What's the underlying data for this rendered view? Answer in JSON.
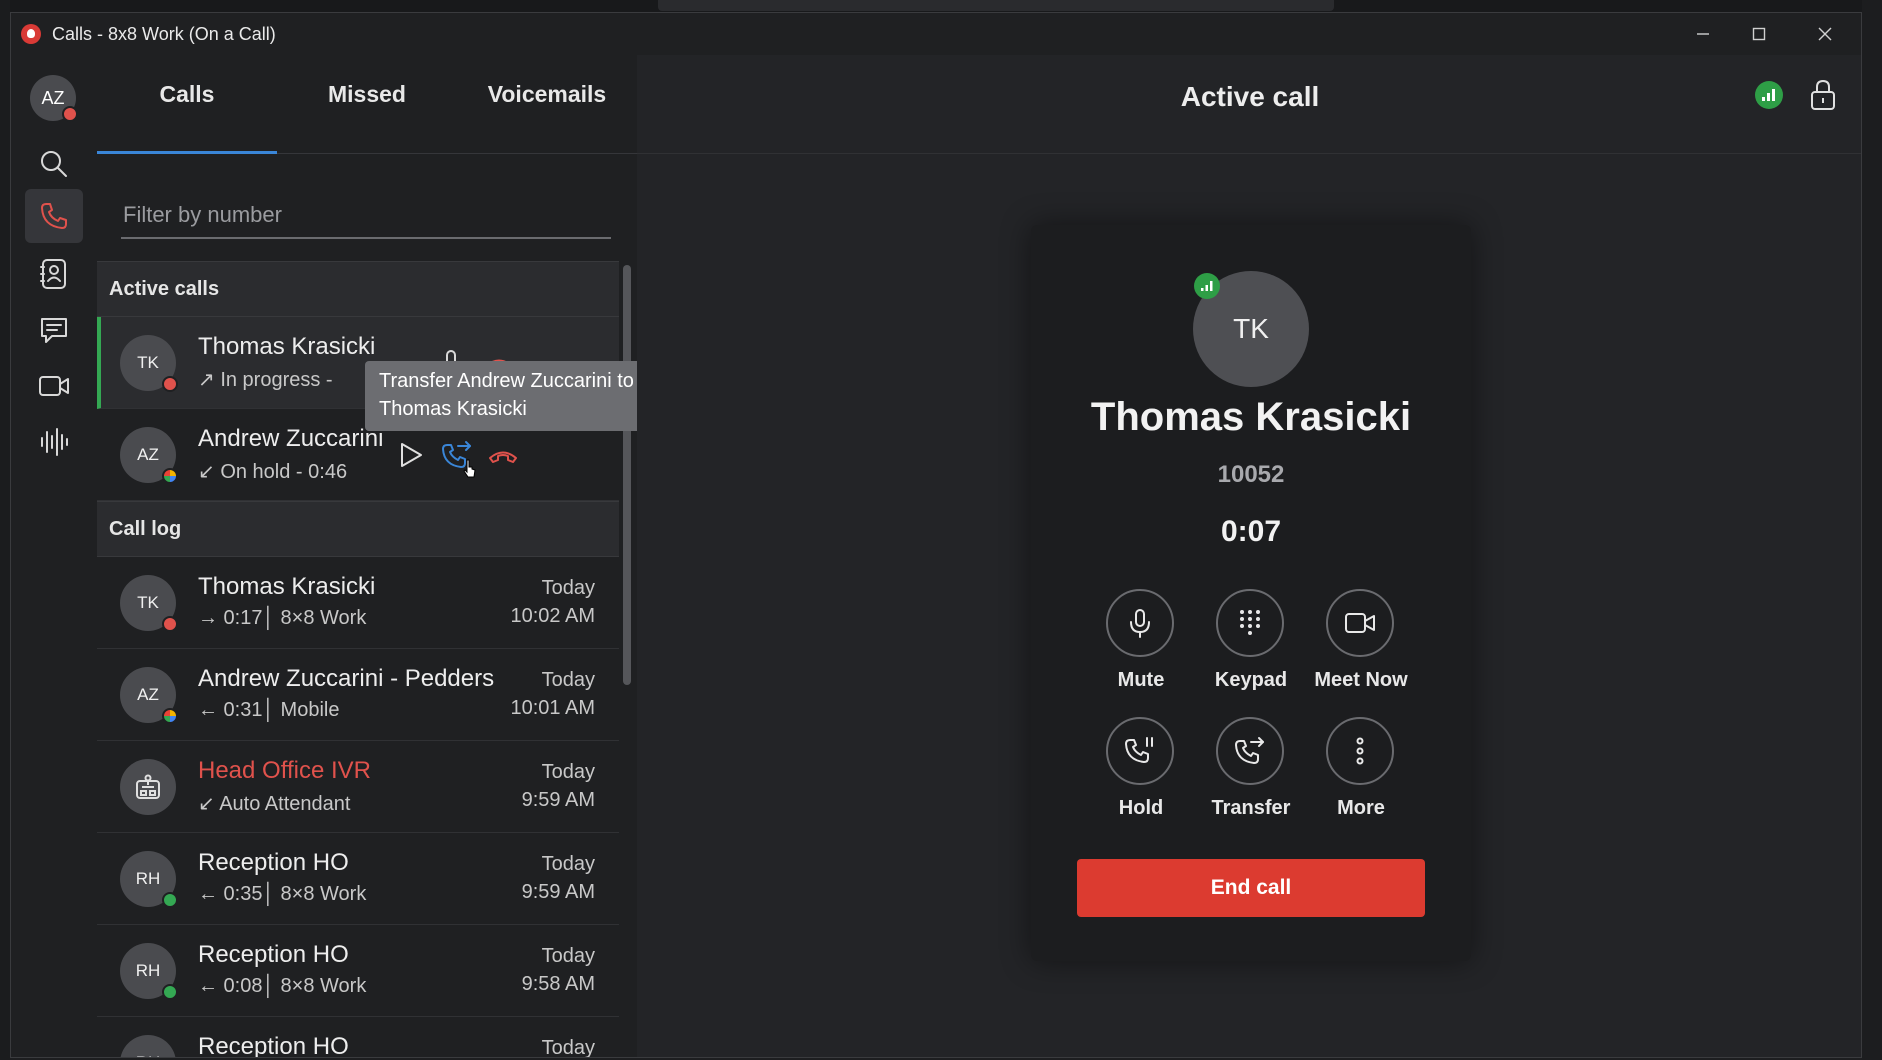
{
  "window": {
    "title": "Calls - 8x8 Work (On a Call)"
  },
  "rail": {
    "avatar_initials": "AZ"
  },
  "tabs": [
    {
      "label": "Calls",
      "active": true
    },
    {
      "label": "Missed",
      "active": false
    },
    {
      "label": "Voicemails",
      "active": false
    }
  ],
  "filter": {
    "placeholder": "Filter by number",
    "value": ""
  },
  "active_calls": {
    "header": "Active calls",
    "items": [
      {
        "initials": "TK",
        "name": "Thomas Krasicki",
        "sub": "↗ In progress -"
      },
      {
        "initials": "AZ",
        "name": "Andrew Zuccarini",
        "sub": "↙ On hold - 0:46"
      }
    ]
  },
  "tooltip": {
    "line1": "Transfer Andrew Zuccarini to",
    "line2": "Thomas Krasicki"
  },
  "call_log": {
    "header": "Call log",
    "items": [
      {
        "initials": "TK",
        "name": "Thomas Krasicki",
        "sub": "→ 0:17│ 8×8 Work",
        "day": "Today",
        "time": "10:02 AM",
        "missed": false
      },
      {
        "initials": "AZ",
        "name": "Andrew Zuccarini - Pedders",
        "sub": "← 0:31│ Mobile",
        "day": "Today",
        "time": "10:01 AM",
        "missed": false
      },
      {
        "initials": "",
        "name": "Head Office IVR",
        "sub": "↙ Auto Attendant",
        "day": "Today",
        "time": "9:59 AM",
        "missed": true
      },
      {
        "initials": "RH",
        "name": "Reception HO",
        "sub": "← 0:35│ 8×8 Work",
        "day": "Today",
        "time": "9:59 AM",
        "missed": false
      },
      {
        "initials": "RH",
        "name": "Reception HO",
        "sub": "← 0:08│ 8×8 Work",
        "day": "Today",
        "time": "9:58 AM",
        "missed": false
      },
      {
        "initials": "RH",
        "name": "Reception HO",
        "sub": "",
        "day": "Today",
        "time": "",
        "missed": false
      }
    ]
  },
  "main": {
    "title": "Active call",
    "caller": {
      "initials": "TK",
      "name": "Thomas Krasicki",
      "ext": "10052",
      "timer": "0:07"
    },
    "controls": {
      "mute": "Mute",
      "keypad": "Keypad",
      "meet_now": "Meet Now",
      "hold": "Hold",
      "transfer": "Transfer",
      "more": "More"
    },
    "end_call": "End call"
  },
  "colors": {
    "accent_blue": "#3a86d8",
    "active_green": "#34a853",
    "end_red": "#dc3b30",
    "missed_red": "#e0524c"
  }
}
